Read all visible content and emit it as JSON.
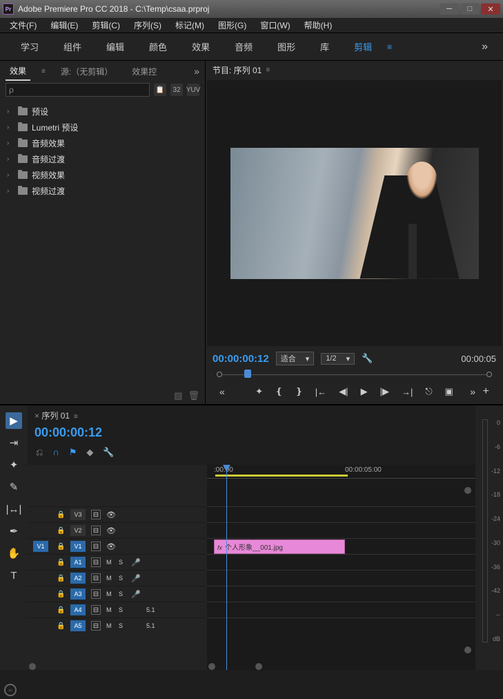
{
  "titlebar": {
    "appicon": "Pr",
    "title": "Adobe Premiere Pro CC 2018 - C:\\Temp\\csaa.prproj"
  },
  "menu": [
    "文件(F)",
    "编辑(E)",
    "剪辑(C)",
    "序列(S)",
    "标记(M)",
    "图形(G)",
    "窗口(W)",
    "帮助(H)"
  ],
  "workspaces": [
    "学习",
    "组件",
    "编辑",
    "颜色",
    "效果",
    "音频",
    "图形",
    "库",
    "剪辑"
  ],
  "leftpane": {
    "tabs": [
      "效果",
      "源:（无剪辑）",
      "效果控"
    ],
    "search_placeholder": "ρ",
    "icons": [
      "📋",
      "32",
      "YUV"
    ],
    "tree": [
      {
        "label": "预设"
      },
      {
        "label": "Lumetri 预设"
      },
      {
        "label": "音频效果"
      },
      {
        "label": "音频过渡"
      },
      {
        "label": "视频效果"
      },
      {
        "label": "视频过渡"
      }
    ]
  },
  "program": {
    "title": "节目: 序列 01",
    "tc": "00:00:00:12",
    "fit": "适合",
    "res": "1/2",
    "dur": "00:00:05"
  },
  "timeline": {
    "title": "序列 01",
    "tc": "00:00:00:12",
    "ruler": [
      ":00:00",
      "00:00:05:00"
    ],
    "vtracks": [
      {
        "lbl": "V3"
      },
      {
        "lbl": "V2"
      },
      {
        "lbl": "V1",
        "src": "V1",
        "on": true
      }
    ],
    "atracks": [
      {
        "lbl": "A1",
        "on": true
      },
      {
        "lbl": "A2",
        "on": true
      },
      {
        "lbl": "A3",
        "on": true
      },
      {
        "lbl": "A4",
        "on": true,
        "ch": "5.1"
      },
      {
        "lbl": "A5",
        "on": true,
        "ch": "5.1"
      }
    ],
    "clip": {
      "name": "个人形象__001.jpg",
      "fx": "fx"
    }
  },
  "meters": {
    "scale": [
      "0",
      "-6",
      "-12",
      "-18",
      "-24",
      "-30",
      "-36",
      "-42",
      "--",
      "dB"
    ]
  }
}
